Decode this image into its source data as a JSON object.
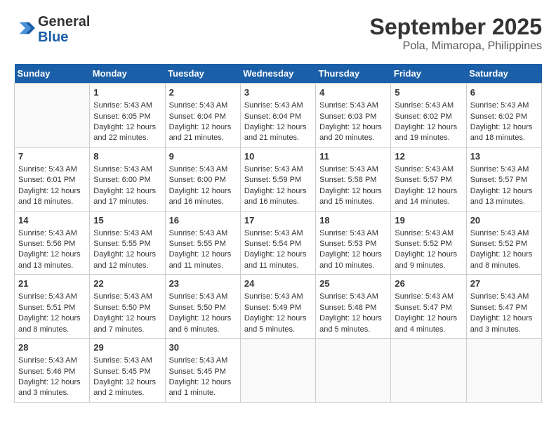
{
  "header": {
    "logo_line1": "General",
    "logo_line2": "Blue",
    "month": "September 2025",
    "location": "Pola, Mimaropa, Philippines"
  },
  "weekdays": [
    "Sunday",
    "Monday",
    "Tuesday",
    "Wednesday",
    "Thursday",
    "Friday",
    "Saturday"
  ],
  "weeks": [
    [
      {
        "day": "",
        "data": ""
      },
      {
        "day": "1",
        "data": "Sunrise: 5:43 AM\nSunset: 6:05 PM\nDaylight: 12 hours\nand 22 minutes."
      },
      {
        "day": "2",
        "data": "Sunrise: 5:43 AM\nSunset: 6:04 PM\nDaylight: 12 hours\nand 21 minutes."
      },
      {
        "day": "3",
        "data": "Sunrise: 5:43 AM\nSunset: 6:04 PM\nDaylight: 12 hours\nand 21 minutes."
      },
      {
        "day": "4",
        "data": "Sunrise: 5:43 AM\nSunset: 6:03 PM\nDaylight: 12 hours\nand 20 minutes."
      },
      {
        "day": "5",
        "data": "Sunrise: 5:43 AM\nSunset: 6:02 PM\nDaylight: 12 hours\nand 19 minutes."
      },
      {
        "day": "6",
        "data": "Sunrise: 5:43 AM\nSunset: 6:02 PM\nDaylight: 12 hours\nand 18 minutes."
      }
    ],
    [
      {
        "day": "7",
        "data": "Sunrise: 5:43 AM\nSunset: 6:01 PM\nDaylight: 12 hours\nand 18 minutes."
      },
      {
        "day": "8",
        "data": "Sunrise: 5:43 AM\nSunset: 6:00 PM\nDaylight: 12 hours\nand 17 minutes."
      },
      {
        "day": "9",
        "data": "Sunrise: 5:43 AM\nSunset: 6:00 PM\nDaylight: 12 hours\nand 16 minutes."
      },
      {
        "day": "10",
        "data": "Sunrise: 5:43 AM\nSunset: 5:59 PM\nDaylight: 12 hours\nand 16 minutes."
      },
      {
        "day": "11",
        "data": "Sunrise: 5:43 AM\nSunset: 5:58 PM\nDaylight: 12 hours\nand 15 minutes."
      },
      {
        "day": "12",
        "data": "Sunrise: 5:43 AM\nSunset: 5:57 PM\nDaylight: 12 hours\nand 14 minutes."
      },
      {
        "day": "13",
        "data": "Sunrise: 5:43 AM\nSunset: 5:57 PM\nDaylight: 12 hours\nand 13 minutes."
      }
    ],
    [
      {
        "day": "14",
        "data": "Sunrise: 5:43 AM\nSunset: 5:56 PM\nDaylight: 12 hours\nand 13 minutes."
      },
      {
        "day": "15",
        "data": "Sunrise: 5:43 AM\nSunset: 5:55 PM\nDaylight: 12 hours\nand 12 minutes."
      },
      {
        "day": "16",
        "data": "Sunrise: 5:43 AM\nSunset: 5:55 PM\nDaylight: 12 hours\nand 11 minutes."
      },
      {
        "day": "17",
        "data": "Sunrise: 5:43 AM\nSunset: 5:54 PM\nDaylight: 12 hours\nand 11 minutes."
      },
      {
        "day": "18",
        "data": "Sunrise: 5:43 AM\nSunset: 5:53 PM\nDaylight: 12 hours\nand 10 minutes."
      },
      {
        "day": "19",
        "data": "Sunrise: 5:43 AM\nSunset: 5:52 PM\nDaylight: 12 hours\nand 9 minutes."
      },
      {
        "day": "20",
        "data": "Sunrise: 5:43 AM\nSunset: 5:52 PM\nDaylight: 12 hours\nand 8 minutes."
      }
    ],
    [
      {
        "day": "21",
        "data": "Sunrise: 5:43 AM\nSunset: 5:51 PM\nDaylight: 12 hours\nand 8 minutes."
      },
      {
        "day": "22",
        "data": "Sunrise: 5:43 AM\nSunset: 5:50 PM\nDaylight: 12 hours\nand 7 minutes."
      },
      {
        "day": "23",
        "data": "Sunrise: 5:43 AM\nSunset: 5:50 PM\nDaylight: 12 hours\nand 6 minutes."
      },
      {
        "day": "24",
        "data": "Sunrise: 5:43 AM\nSunset: 5:49 PM\nDaylight: 12 hours\nand 5 minutes."
      },
      {
        "day": "25",
        "data": "Sunrise: 5:43 AM\nSunset: 5:48 PM\nDaylight: 12 hours\nand 5 minutes."
      },
      {
        "day": "26",
        "data": "Sunrise: 5:43 AM\nSunset: 5:47 PM\nDaylight: 12 hours\nand 4 minutes."
      },
      {
        "day": "27",
        "data": "Sunrise: 5:43 AM\nSunset: 5:47 PM\nDaylight: 12 hours\nand 3 minutes."
      }
    ],
    [
      {
        "day": "28",
        "data": "Sunrise: 5:43 AM\nSunset: 5:46 PM\nDaylight: 12 hours\nand 3 minutes."
      },
      {
        "day": "29",
        "data": "Sunrise: 5:43 AM\nSunset: 5:45 PM\nDaylight: 12 hours\nand 2 minutes."
      },
      {
        "day": "30",
        "data": "Sunrise: 5:43 AM\nSunset: 5:45 PM\nDaylight: 12 hours\nand 1 minute."
      },
      {
        "day": "",
        "data": ""
      },
      {
        "day": "",
        "data": ""
      },
      {
        "day": "",
        "data": ""
      },
      {
        "day": "",
        "data": ""
      }
    ]
  ]
}
